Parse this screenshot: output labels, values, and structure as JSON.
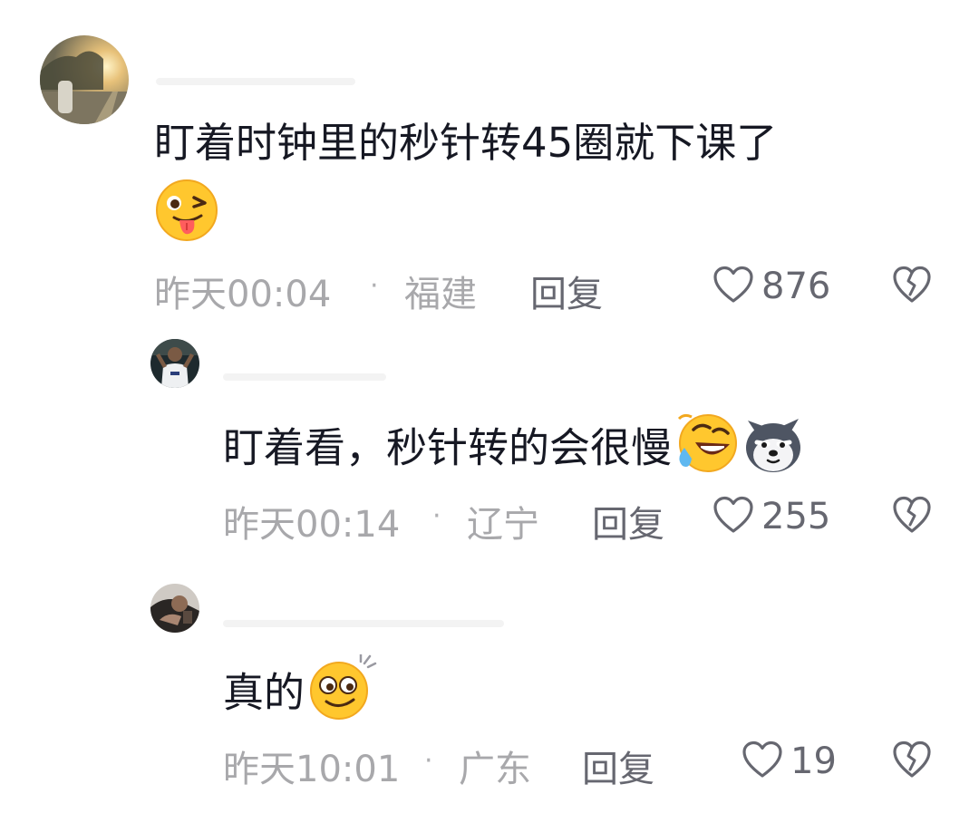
{
  "comments": [
    {
      "text": "盯着时钟里的秒针转45圈就下课了",
      "emoji": "tongue-wink-emoji",
      "time": "昨天00:04",
      "location": "福建",
      "reply_label": "回复",
      "likes": "876"
    },
    {
      "text": "盯着看，秒针转的会很慢",
      "emoji": [
        "rolling-laughing-emoji",
        "husky-dog-emoji"
      ],
      "time": "昨天00:14",
      "location": "辽宁",
      "reply_label": "回复",
      "likes": "255"
    },
    {
      "text": "真的",
      "emoji": "dizzy-smile-emoji",
      "time": "昨天10:01",
      "location": "广东",
      "reply_label": "回复",
      "likes": "19"
    }
  ],
  "separator": "·",
  "colors": {
    "text_primary": "#161823",
    "text_meta": "#a8a8ab",
    "text_action": "#666770"
  }
}
